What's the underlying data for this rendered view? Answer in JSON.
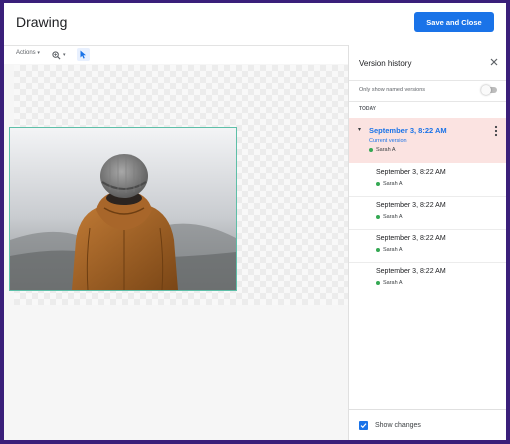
{
  "header": {
    "title": "Drawing",
    "save_label": "Save and Close"
  },
  "toolbar": {
    "actions_label": "Actions",
    "icons": [
      "zoom-icon",
      "select-pointer-icon"
    ]
  },
  "version_panel": {
    "title": "Version history",
    "named_only_label": "Only show named versions",
    "named_only_enabled": false,
    "group_label": "TODAY",
    "current": {
      "date": "September 3, 8:22 AM",
      "status": "Current version",
      "user": "Sarah A"
    },
    "versions": [
      {
        "date": "September 3, 8:22 AM",
        "user": "Sarah A"
      },
      {
        "date": "September 3, 8:22 AM",
        "user": "Sarah A"
      },
      {
        "date": "September 3, 8:22 AM",
        "user": "Sarah A"
      },
      {
        "date": "September 3, 8:22 AM",
        "user": "Sarah A"
      }
    ],
    "show_changes_label": "Show changes",
    "show_changes_checked": true
  },
  "colors": {
    "primary": "#1a73e8",
    "current_bg": "#fbe3e1",
    "user_dot": "#34a853",
    "annotation_arrow": "#3a1f7a"
  }
}
